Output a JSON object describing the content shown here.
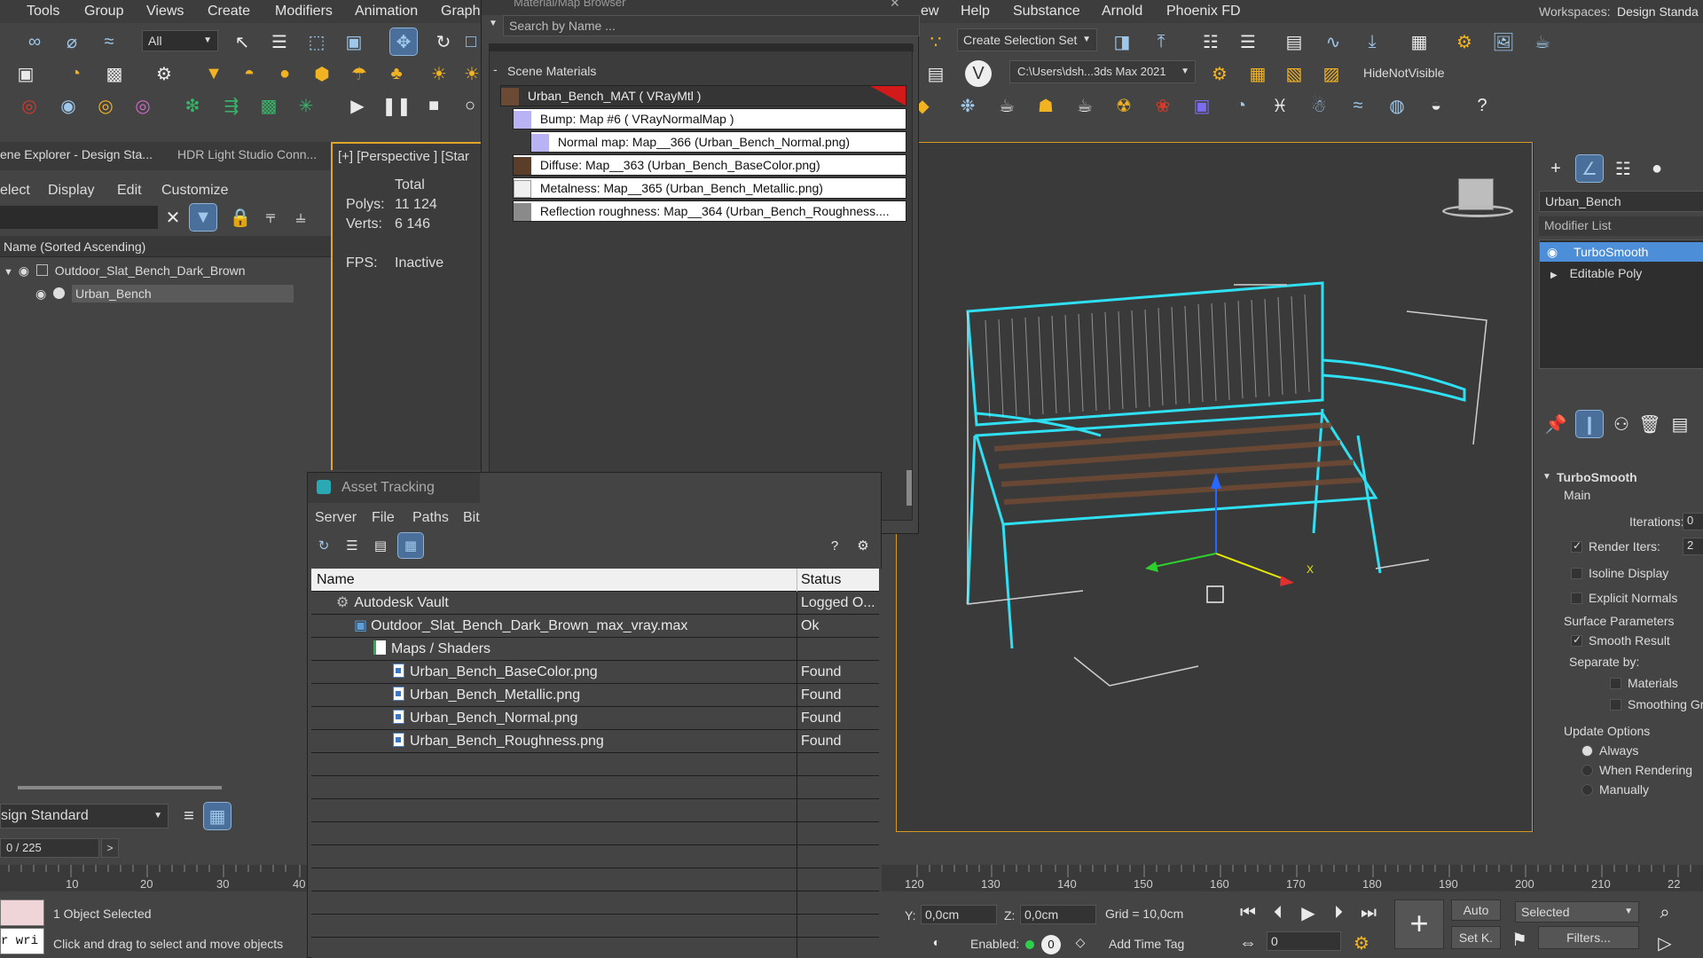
{
  "menubar": {
    "items": [
      "Tools",
      "Group",
      "Views",
      "Create",
      "Modifiers",
      "Animation",
      "Graph",
      "ew",
      "Help",
      "Substance",
      "Arnold",
      "Phoenix FD"
    ],
    "workspaces_label": "Workspaces:",
    "workspace_value": "Design Standa"
  },
  "toolbar": {
    "filter_value": "All",
    "selection_set_placeholder": "Create Selection Set",
    "path_value": "C:\\Users\\dsh...3ds Max 2021",
    "hide_label": "HideNotVisible"
  },
  "scene_explorer": {
    "tab_active": "ene Explorer - Design Sta...",
    "tab_other": "HDR Light Studio Conn...",
    "menu": [
      "elect",
      "Display",
      "Edit",
      "Customize"
    ],
    "column_header": "Name (Sorted Ascending)",
    "items": [
      {
        "label": "Outdoor_Slat_Bench_Dark_Brown"
      },
      {
        "label": "Urban_Bench"
      }
    ],
    "layer_value": "sign Standard",
    "frame_value": "0 / 225"
  },
  "viewport_left": {
    "label": "[+] [Perspective ] [Star",
    "total_label": "Total",
    "polys_label": "Polys:",
    "polys_value": "11 124",
    "verts_label": "Verts:",
    "verts_value": "6 146",
    "fps_label": "FPS:",
    "fps_value": "Inactive"
  },
  "material_browser": {
    "title": "Material/Map Browser",
    "search_placeholder": "Search by Name ...",
    "section": "Scene Materials",
    "items": [
      {
        "label": "Urban_Bench_MAT  ( VRayMtl )"
      },
      {
        "label": "Bump: Map #6  ( VRayNormalMap )"
      },
      {
        "label": "Normal map: Map__366 (Urban_Bench_Normal.png)"
      },
      {
        "label": "Diffuse: Map__363 (Urban_Bench_BaseColor.png)"
      },
      {
        "label": "Metalness: Map__365 (Urban_Bench_Metallic.png)"
      },
      {
        "label": "Reflection  roughness:  Map__364  (Urban_Bench_Roughness...."
      }
    ]
  },
  "asset_tracking": {
    "title": "Asset Tracking",
    "menu": [
      "Server",
      "File",
      "Paths",
      "Bit"
    ],
    "col_name": "Name",
    "col_status": "Status",
    "rows": [
      {
        "name": "Autodesk Vault",
        "status": "Logged O..."
      },
      {
        "name": "Outdoor_Slat_Bench_Dark_Brown_max_vray.max",
        "status": "Ok"
      },
      {
        "name": "Maps / Shaders",
        "status": ""
      },
      {
        "name": "Urban_Bench_BaseColor.png",
        "status": "Found"
      },
      {
        "name": "Urban_Bench_Metallic.png",
        "status": "Found"
      },
      {
        "name": "Urban_Bench_Normal.png",
        "status": "Found"
      },
      {
        "name": "Urban_Bench_Roughness.png",
        "status": "Found"
      }
    ]
  },
  "command_panel": {
    "object_name": "Urban_Bench",
    "modifier_list_label": "Modifier List",
    "stack": [
      "TurboSmooth",
      "Editable Poly"
    ],
    "rollout_title": "TurboSmooth",
    "main_label": "Main",
    "iterations_label": "Iterations:",
    "iterations_value": "0",
    "render_iters_label": "Render Iters:",
    "render_iters_value": "2",
    "isoline_label": "Isoline Display",
    "explicit_label": "Explicit Normals",
    "surface_params_label": "Surface Parameters",
    "smooth_result_label": "Smooth Result",
    "separate_by_label": "Separate by:",
    "materials_label": "Materials",
    "smoothing_label": "Smoothing Gr",
    "update_options_label": "Update Options",
    "always_label": "Always",
    "when_rendering_label": "When Rendering",
    "manually_label": "Manually"
  },
  "timeline": {
    "ticks_left": [
      "10",
      "20",
      "30",
      "40"
    ],
    "ticks_right": [
      "120",
      "130",
      "140",
      "150",
      "160",
      "170",
      "180",
      "190",
      "200",
      "210",
      "22"
    ]
  },
  "status": {
    "maxscript_text": "r wri",
    "selected_text": "1 Object Selected",
    "hint_text": "Click and drag to select and move objects",
    "y_label": "Y:",
    "y_value": "0,0cm",
    "z_label": "Z:",
    "z_value": "0,0cm",
    "grid_text": "Grid = 10,0cm",
    "enabled_label": "Enabled:",
    "enabled_value": "0",
    "add_time_tag": "Add Time Tag",
    "auto_label": "Auto",
    "setkey_label": "Set K.",
    "selected_dropdown": "Selected",
    "filters_label": "Filters...",
    "frame_value": "0"
  },
  "gizmo": {
    "x_label": "X"
  },
  "colors": {
    "accent": "#4c8ed8",
    "wire": "#2fe0f2",
    "panel": "#444444"
  }
}
